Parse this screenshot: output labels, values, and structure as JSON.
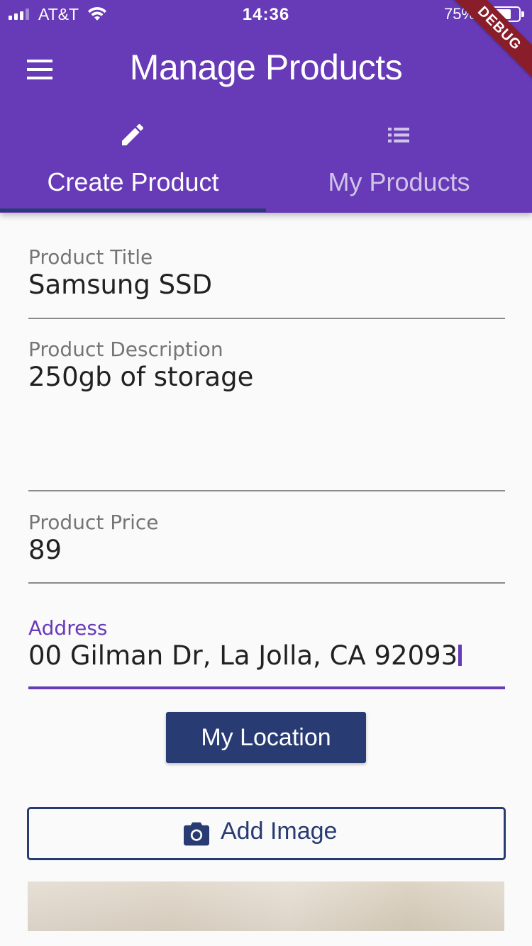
{
  "status_bar": {
    "carrier": "AT&T",
    "time": "14:36",
    "battery": "75%"
  },
  "debug_banner": "DEBUG",
  "app_bar": {
    "title": "Manage Products",
    "menu_icon": "hamburger-menu-icon"
  },
  "tabs": [
    {
      "label": "Create Product",
      "icon": "pencil-icon",
      "selected": true
    },
    {
      "label": "My Products",
      "icon": "list-icon",
      "selected": false
    }
  ],
  "form": {
    "title": {
      "label": "Product Title",
      "value": "Samsung SSD"
    },
    "description": {
      "label": "Product Description",
      "value": "250gb of storage"
    },
    "price": {
      "label": "Product Price",
      "value": "89"
    },
    "address": {
      "label": "Address",
      "value": "00 Gilman Dr, La Jolla, CA 92093"
    }
  },
  "buttons": {
    "my_location": "My Location",
    "add_image": "Add Image"
  },
  "colors": {
    "primary": "#673ab7",
    "accent": "#283b72",
    "background": "#fafafa"
  }
}
